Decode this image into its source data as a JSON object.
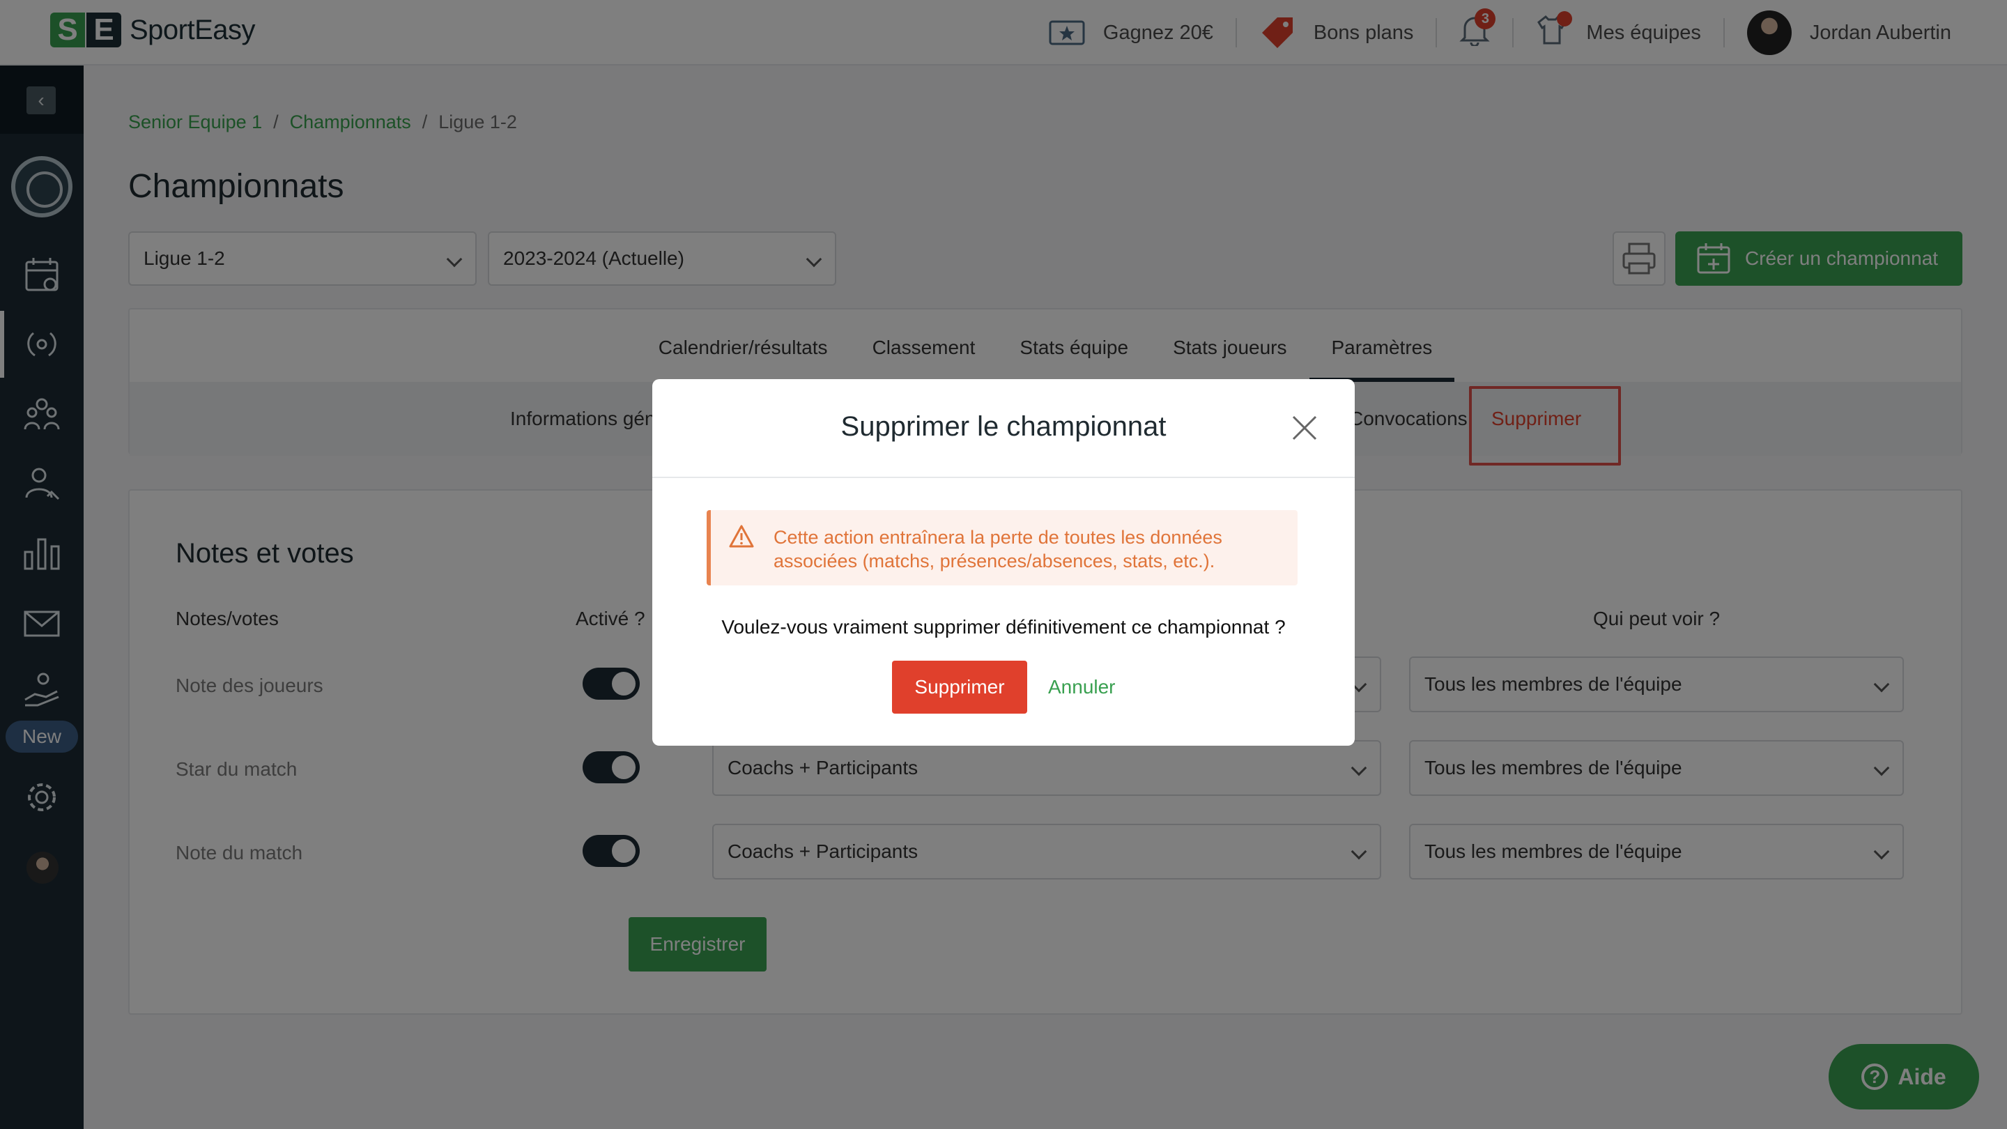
{
  "brand": {
    "name": "SportEasy",
    "mark_left": "S",
    "mark_right": "E",
    "green": "#3aa252",
    "dark": "#1c2b34",
    "danger": "#e0402c"
  },
  "topnav": {
    "earn_label": "Gagnez 20€",
    "deals_label": "Bons plans",
    "notifications_count": "3",
    "teams_label": "Mes équipes",
    "user_name": "Jordan Aubertin"
  },
  "sidebar": {
    "collapse_icon": "‹",
    "items": [
      "calendar-icon",
      "championship-laurel-icon",
      "team-members-icon",
      "player-stats-icon",
      "stats-bars-icon",
      "mail-icon",
      "volunteer-hand-icon",
      "settings-gear-icon"
    ],
    "new_badge": "New"
  },
  "breadcrumb": {
    "items": [
      "Senior Equipe 1",
      "Championnats",
      "Ligue 1-2"
    ],
    "separator": "/"
  },
  "page": {
    "title": "Championnats",
    "league_select": "Ligue 1-2",
    "season_select": "2023-2024 (Actuelle)",
    "create_button": "Créer un championnat"
  },
  "tabs": [
    "Calendrier/résultats",
    "Classement",
    "Stats équipe",
    "Stats joueurs",
    "Paramètres"
  ],
  "active_tab": "Paramètres",
  "subtabs": {
    "info": "Informations gén",
    "convocations": "Convocations",
    "supprimer": "Supprimer"
  },
  "notes": {
    "title": "Notes et votes",
    "col_notes": "Notes/votes",
    "col_active": "Activé ?",
    "col_visibility": "Qui peut voir ?",
    "rows": [
      {
        "label": "Note des joueurs",
        "enabled": true,
        "voters": "",
        "visibility": "Tous les membres de l'équipe"
      },
      {
        "label": "Star du match",
        "enabled": true,
        "voters": "Coachs + Participants",
        "visibility": "Tous les membres de l'équipe"
      },
      {
        "label": "Note du match",
        "enabled": true,
        "voters": "Coachs + Participants",
        "visibility": "Tous les membres de l'équipe"
      }
    ],
    "save_button": "Enregistrer"
  },
  "help": {
    "label": "Aide"
  },
  "modal": {
    "title": "Supprimer le championnat",
    "warning": "Cette action entraînera la perte de toutes les données associées (matchs, présences/absences, stats, etc.).",
    "question": "Voulez-vous vraiment supprimer définitivement ce championnat ?",
    "confirm_button": "Supprimer",
    "cancel_button": "Annuler"
  }
}
